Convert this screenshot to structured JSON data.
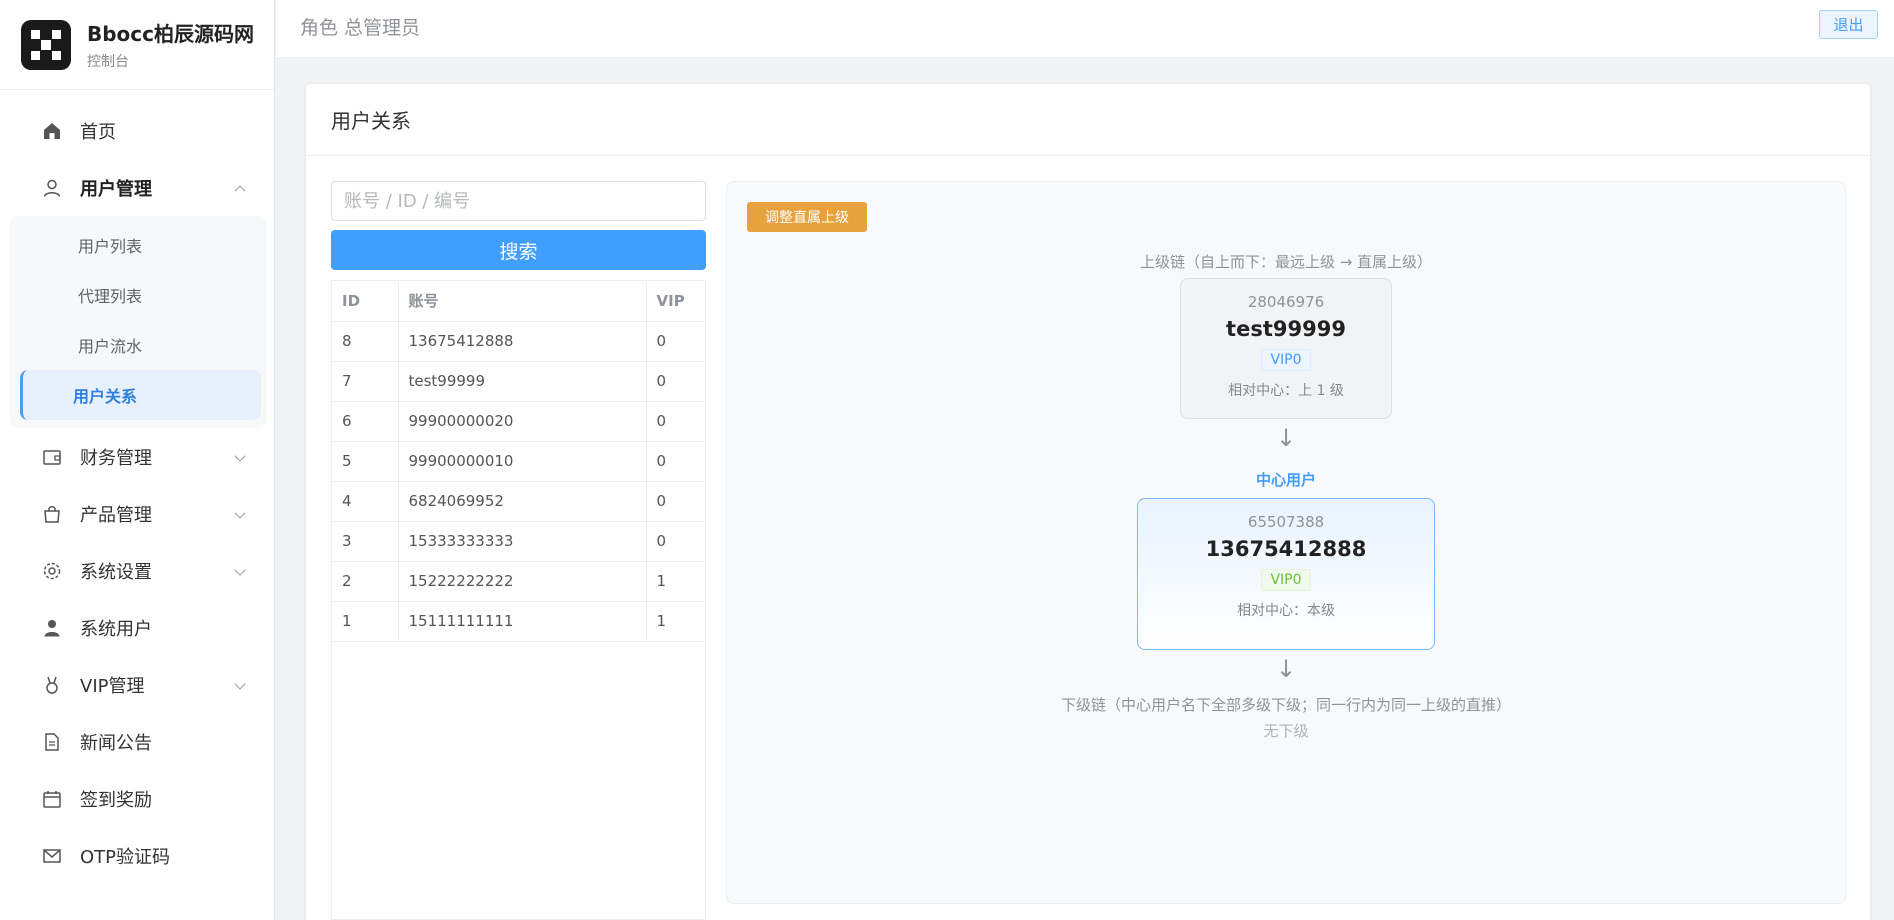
{
  "brand": {
    "title": "Bbocc柏辰源码网",
    "subtitle": "控制台"
  },
  "sidebar": {
    "items": [
      {
        "label": "首页",
        "icon": "home-icon"
      },
      {
        "label": "用户管理",
        "icon": "user-icon",
        "expanded": true
      },
      {
        "label": "财务管理",
        "icon": "wallet-icon"
      },
      {
        "label": "产品管理",
        "icon": "bag-icon"
      },
      {
        "label": "系统设置",
        "icon": "gear-icon"
      },
      {
        "label": "系统用户",
        "icon": "person-icon"
      },
      {
        "label": "VIP管理",
        "icon": "medal-icon"
      },
      {
        "label": "新闻公告",
        "icon": "document-icon"
      },
      {
        "label": "签到奖励",
        "icon": "calendar-icon"
      },
      {
        "label": "OTP验证码",
        "icon": "mail-icon"
      }
    ],
    "user_submenu": [
      {
        "label": "用户列表"
      },
      {
        "label": "代理列表"
      },
      {
        "label": "用户流水"
      },
      {
        "label": "用户关系",
        "active": true
      }
    ]
  },
  "header": {
    "role_title": "角色 总管理员",
    "logout_label": "退出"
  },
  "card": {
    "title": "用户关系"
  },
  "search": {
    "placeholder": "账号 / ID / 编号",
    "value": "",
    "button_label": "搜索"
  },
  "table": {
    "headers": [
      "ID",
      "账号",
      "VIP"
    ],
    "rows": [
      {
        "id": "8",
        "account": "13675412888",
        "vip": "0"
      },
      {
        "id": "7",
        "account": "test99999",
        "vip": "0"
      },
      {
        "id": "6",
        "account": "99900000020",
        "vip": "0"
      },
      {
        "id": "5",
        "account": "99900000010",
        "vip": "0"
      },
      {
        "id": "4",
        "account": "6824069952",
        "vip": "0"
      },
      {
        "id": "3",
        "account": "15333333333",
        "vip": "0"
      },
      {
        "id": "2",
        "account": "15222222222",
        "vip": "1"
      },
      {
        "id": "1",
        "account": "15111111111",
        "vip": "1"
      }
    ]
  },
  "relation": {
    "adjust_button_label": "调整直属上级",
    "upper_chain_label": "上级链（自上而下：最远上级 → 直属上级）",
    "upper_nodes": [
      {
        "code": "28046976",
        "name": "test99999",
        "vip": "VIP0",
        "relative": "相对中心：上 1 级"
      }
    ],
    "arrow_glyph": "↓",
    "center_label": "中心用户",
    "center_node": {
      "code": "65507388",
      "name": "13675412888",
      "vip": "VIP0",
      "relative": "相对中心：本级"
    },
    "lower_chain_label": "下级链（中心用户名下全部多级下级；同一行内为同一上级的直推）",
    "no_lower_text": "无下级"
  },
  "colors": {
    "primary": "#409eff",
    "warning": "#e6a23c",
    "success": "#67c23a"
  }
}
